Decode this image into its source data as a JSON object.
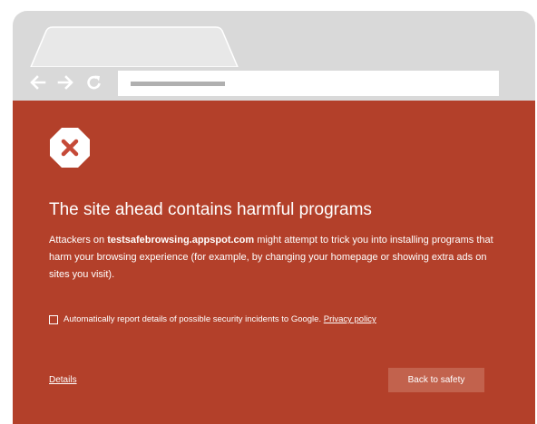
{
  "toolbar": {
    "back_icon": "arrow-left-icon",
    "forward_icon": "arrow-right-icon",
    "reload_icon": "reload-icon"
  },
  "interstitial": {
    "heading": "The site ahead contains harmful programs",
    "message_before": "Attackers on ",
    "site_name": "testsafebrowsing.appspot.com",
    "message_after": " might attempt to trick you into installing programs that harm your browsing experience (for example, by changing your homepage or showing extra ads on sites you visit).",
    "report_label": "Automatically report details of possible security incidents to Google. ",
    "privacy_link": "Privacy policy",
    "details_link": "Details",
    "back_button": "Back to safety"
  },
  "colors": {
    "frame": "#d9d9d9",
    "interstitial_background": "#b3402a",
    "button_background": "#c2624d",
    "badge_x": "#c54a38"
  }
}
